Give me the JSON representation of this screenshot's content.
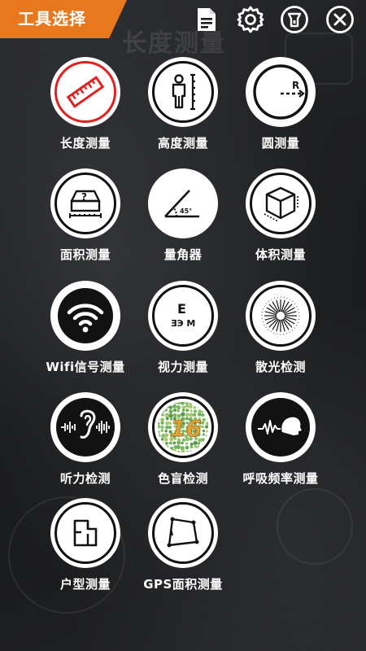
{
  "header": {
    "title": "工具选择",
    "icons": [
      "document-icon",
      "gear-icon",
      "flashlight-icon",
      "close-icon"
    ]
  },
  "background": {
    "watermark_title": "长度测量"
  },
  "tools": [
    {
      "label": "长度测量",
      "icon": "ruler-icon",
      "selected": true
    },
    {
      "label": "高度测量",
      "icon": "person-height-icon",
      "selected": false
    },
    {
      "label": "圆测量",
      "icon": "circle-radius-icon",
      "selected": false
    },
    {
      "label": "面积测量",
      "icon": "area-box-icon",
      "selected": false
    },
    {
      "label": "量角器",
      "icon": "protractor-icon",
      "selected": false
    },
    {
      "label": "体积测量",
      "icon": "cube-icon",
      "selected": false
    },
    {
      "label": "Wifi信号测量",
      "icon": "wifi-icon",
      "selected": false
    },
    {
      "label": "视力测量",
      "icon": "eye-chart-icon",
      "selected": false
    },
    {
      "label": "散光检测",
      "icon": "astigmatism-icon",
      "selected": false
    },
    {
      "label": "听力检测",
      "icon": "ear-icon",
      "selected": false
    },
    {
      "label": "色盲检测",
      "icon": "color-blind-icon",
      "selected": false
    },
    {
      "label": "呼吸频率测量",
      "icon": "breath-icon",
      "selected": false
    },
    {
      "label": "户型测量",
      "icon": "floorplan-icon",
      "selected": false
    },
    {
      "label": "GPS面积测量",
      "icon": "gps-area-icon",
      "selected": false
    }
  ],
  "icon_texts": {
    "circle_r": "R",
    "protractor_deg": "45°",
    "color_blind_number": "16",
    "eye_chart_top": "E",
    "eye_chart_row": "ƎЭ M"
  },
  "colors": {
    "accent": "#e8781e",
    "selected_ring": "#e22020",
    "background": "#1b1c1e"
  }
}
